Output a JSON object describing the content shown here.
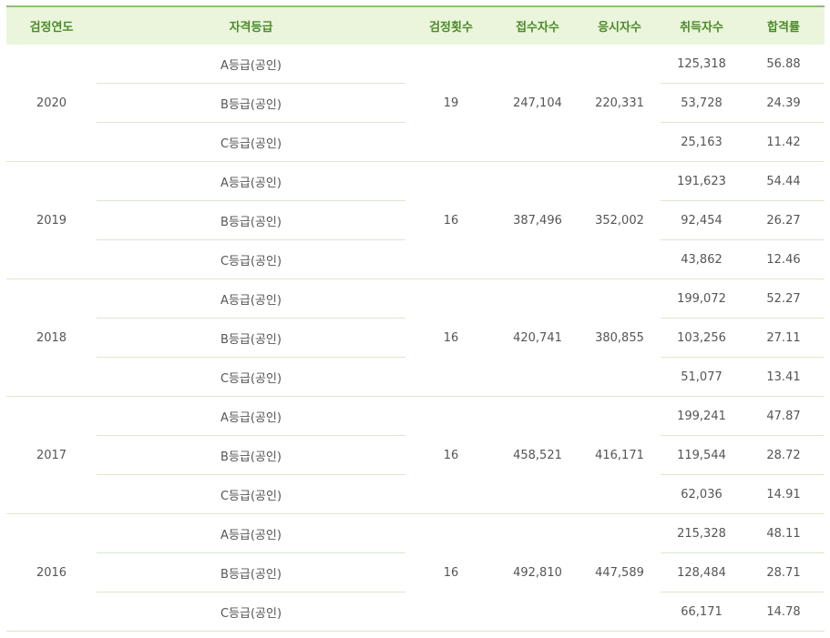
{
  "headers": {
    "year": "검정연도",
    "grade": "자격등급",
    "count": "검정횟수",
    "applicants": "접수자수",
    "examinees": "응시자수",
    "obtained": "취득자수",
    "pass_rate": "합격률"
  },
  "rows": [
    {
      "year": "2020",
      "count": "19",
      "applicants": "247,104",
      "examinees": "220,331",
      "grades": [
        {
          "grade": "A등급(공인)",
          "obtained": "125,318",
          "rate": "56.88"
        },
        {
          "grade": "B등급(공인)",
          "obtained": "53,728",
          "rate": "24.39"
        },
        {
          "grade": "C등급(공인)",
          "obtained": "25,163",
          "rate": "11.42"
        }
      ]
    },
    {
      "year": "2019",
      "count": "16",
      "applicants": "387,496",
      "examinees": "352,002",
      "grades": [
        {
          "grade": "A등급(공인)",
          "obtained": "191,623",
          "rate": "54.44"
        },
        {
          "grade": "B등급(공인)",
          "obtained": "92,454",
          "rate": "26.27"
        },
        {
          "grade": "C등급(공인)",
          "obtained": "43,862",
          "rate": "12.46"
        }
      ]
    },
    {
      "year": "2018",
      "count": "16",
      "applicants": "420,741",
      "examinees": "380,855",
      "grades": [
        {
          "grade": "A등급(공인)",
          "obtained": "199,072",
          "rate": "52.27"
        },
        {
          "grade": "B등급(공인)",
          "obtained": "103,256",
          "rate": "27.11"
        },
        {
          "grade": "C등급(공인)",
          "obtained": "51,077",
          "rate": "13.41"
        }
      ]
    },
    {
      "year": "2017",
      "count": "16",
      "applicants": "458,521",
      "examinees": "416,171",
      "grades": [
        {
          "grade": "A등급(공인)",
          "obtained": "199,241",
          "rate": "47.87"
        },
        {
          "grade": "B등급(공인)",
          "obtained": "119,544",
          "rate": "28.72"
        },
        {
          "grade": "C등급(공인)",
          "obtained": "62,036",
          "rate": "14.91"
        }
      ]
    },
    {
      "year": "2016",
      "count": "16",
      "applicants": "492,810",
      "examinees": "447,589",
      "grades": [
        {
          "grade": "A등급(공인)",
          "obtained": "215,328",
          "rate": "48.11"
        },
        {
          "grade": "B등급(공인)",
          "obtained": "128,484",
          "rate": "28.71"
        },
        {
          "grade": "C등급(공인)",
          "obtained": "66,171",
          "rate": "14.78"
        }
      ]
    }
  ],
  "colors": {
    "header_bg": "#eaf5dc",
    "header_text": "#4d8a2a",
    "header_border": "#8cc06a",
    "row_border": "#dbe8cc",
    "cell_text": "#555555"
  }
}
